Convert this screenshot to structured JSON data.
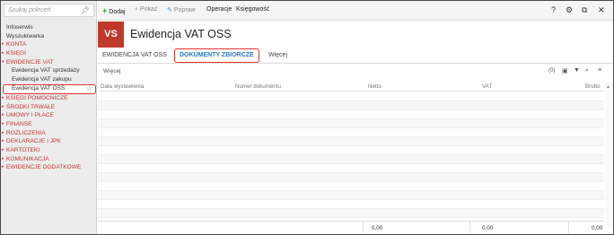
{
  "sidebar": {
    "search_placeholder": "Szukaj poleceń",
    "items": [
      {
        "label": "Infoserwis",
        "kind": "plain"
      },
      {
        "label": "Wyszukiwarka",
        "kind": "plain"
      },
      {
        "label": "KONTA",
        "kind": "group"
      },
      {
        "label": "KSIĘGI",
        "kind": "group"
      },
      {
        "label": "EWIDENCJE VAT",
        "kind": "group-open"
      },
      {
        "label": "Ewidencja VAT sprzedaży",
        "kind": "sub"
      },
      {
        "label": "Ewidencja VAT zakupu",
        "kind": "sub"
      },
      {
        "label": "Ewidencja VAT OSS",
        "kind": "active"
      },
      {
        "label": "KSIĘGI POMOCNICZE",
        "kind": "group"
      },
      {
        "label": "ŚRODKI TRWAŁE",
        "kind": "group"
      },
      {
        "label": "UMOWY I PŁACE",
        "kind": "group"
      },
      {
        "label": "FINANSE",
        "kind": "group"
      },
      {
        "label": "ROZLICZENIA",
        "kind": "group"
      },
      {
        "label": "DEKLARACJE I JPK",
        "kind": "group"
      },
      {
        "label": "KARTOTEKI",
        "kind": "group"
      },
      {
        "label": "KOMUNIKACJA",
        "kind": "group"
      },
      {
        "label": "EWIDENCJE DODATKOWE",
        "kind": "group"
      }
    ]
  },
  "toolbar": {
    "add": "Dodaj",
    "show": "Pokaż",
    "edit": "Popraw",
    "operations": "Operacje",
    "accounting": "Księgowość"
  },
  "header": {
    "badge": "VS",
    "title": "Ewidencja VAT OSS"
  },
  "tabs": [
    "EWIDENCJA VAT OSS",
    "DOKUMENTY ZBIORCZE",
    "Więcej"
  ],
  "grid": {
    "more": "Więcej",
    "count": "(0)",
    "columns": [
      "Data wystawienia",
      "Numer dokumentu",
      "Netto",
      "VAT",
      "Brutto"
    ],
    "totals": {
      "netto": "0,00",
      "vat": "0,00",
      "brutto": "0,00"
    }
  },
  "colors": {
    "accent": "#c0392b",
    "highlight": "#e0342f",
    "tab_active": "#2b7bb9"
  }
}
